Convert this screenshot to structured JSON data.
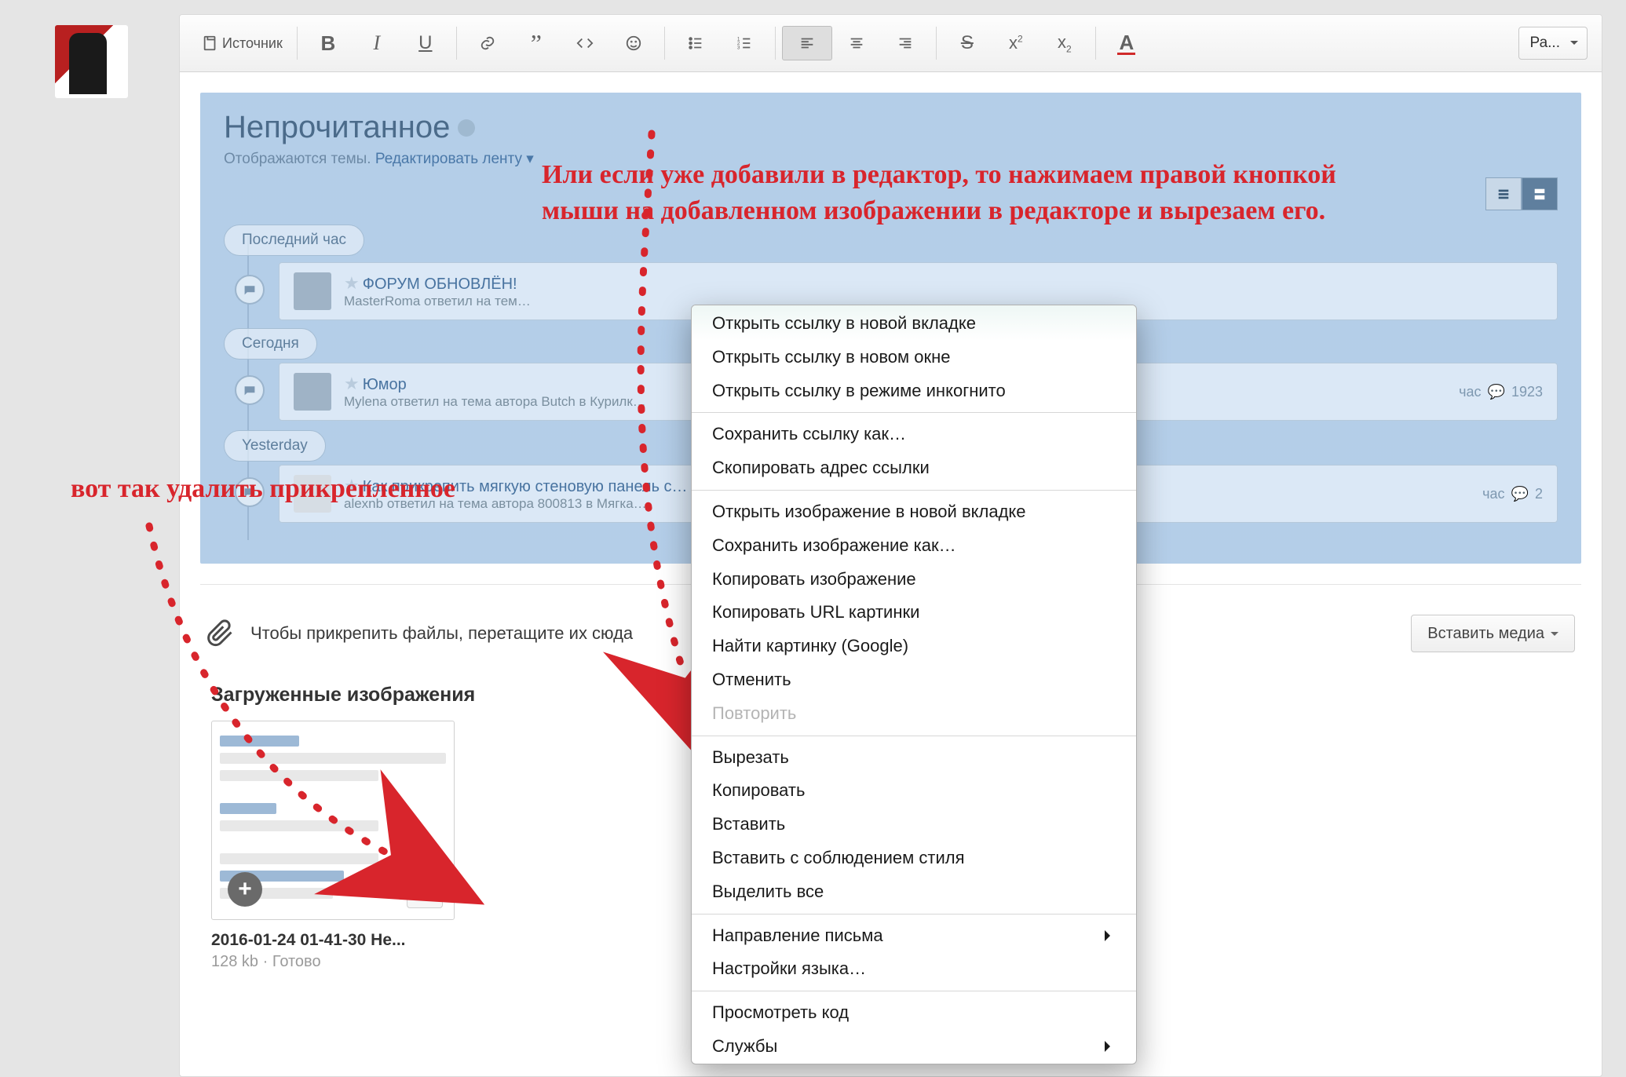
{
  "toolbar": {
    "source_label": "Источник",
    "font_selector": "Ра..."
  },
  "forum": {
    "title": "Непрочитанное",
    "subtitle_prefix": "Отображаются темы.",
    "subtitle_link": "Редактировать ленту",
    "pills": {
      "last_hour": "Последний час",
      "today": "Сегодня",
      "yesterday": "Yesterday"
    },
    "rows": [
      {
        "title": "ФОРУМ ОБНОВЛЁН!",
        "sub": "MasterRoma ответил на тем…",
        "meta": ""
      },
      {
        "title": "Юмор",
        "sub": "Mylena ответил на тема автора Butch в Курилк…",
        "meta_time": "час",
        "meta_count": "1923"
      },
      {
        "title": "Как прикрепить мягкую стеновую панель с…",
        "sub": "alexnb ответил на тема автора 800813 в Мягка…",
        "meta_time": "час",
        "meta_count": "2"
      }
    ]
  },
  "annotations": {
    "right": "Или если уже добавили в редактор, то нажимаем правой кнопкой мыши на добавленном изображении в редакторе и вырезаем его.",
    "left": "вот так удалить прикрепленное"
  },
  "attach": {
    "hint": "Чтобы прикрепить файлы, перетащите их сюда",
    "media_btn": "Вставить медиа",
    "uploaded_title": "Загруженные изображения",
    "file": {
      "name": "2016-01-24 01-41-30 Не...",
      "meta": "128 kb · Готово"
    }
  },
  "context_menu": {
    "items": [
      {
        "label": "Открыть ссылку в новой вкладке",
        "type": "item",
        "grp": "top"
      },
      {
        "label": "Открыть ссылку в новом окне",
        "type": "item"
      },
      {
        "label": "Открыть ссылку в режиме инкогнито",
        "type": "item"
      },
      {
        "type": "hr"
      },
      {
        "label": "Сохранить ссылку как…",
        "type": "item"
      },
      {
        "label": "Скопировать адрес ссылки",
        "type": "item"
      },
      {
        "type": "hr"
      },
      {
        "label": "Открыть изображение в новой вкладке",
        "type": "item"
      },
      {
        "label": "Сохранить изображение как…",
        "type": "item"
      },
      {
        "label": "Копировать изображение",
        "type": "item"
      },
      {
        "label": "Копировать URL картинки",
        "type": "item"
      },
      {
        "label": "Найти картинку (Google)",
        "type": "item"
      },
      {
        "label": "Отменить",
        "type": "item"
      },
      {
        "label": "Повторить",
        "type": "item",
        "disabled": true
      },
      {
        "type": "hr"
      },
      {
        "label": "Вырезать",
        "type": "item"
      },
      {
        "label": "Копировать",
        "type": "item"
      },
      {
        "label": "Вставить",
        "type": "item"
      },
      {
        "label": "Вставить с соблюдением стиля",
        "type": "item"
      },
      {
        "label": "Выделить все",
        "type": "item"
      },
      {
        "type": "hr"
      },
      {
        "label": "Направление письма",
        "type": "sub"
      },
      {
        "label": "Настройки языка…",
        "type": "item"
      },
      {
        "type": "hr"
      },
      {
        "label": "Просмотреть код",
        "type": "item"
      },
      {
        "label": "Службы",
        "type": "sub"
      }
    ]
  }
}
